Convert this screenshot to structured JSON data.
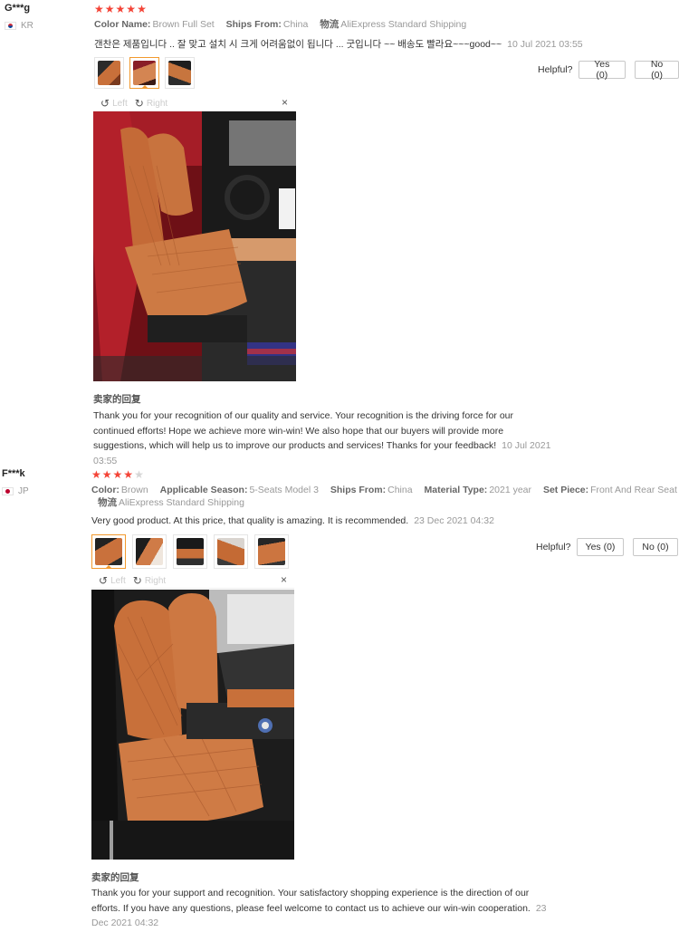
{
  "reviews": [
    {
      "user": "G***g",
      "country": "KR",
      "rating": 5,
      "attributes": [
        {
          "label": "Color Name:",
          "value": "Brown Full Set"
        },
        {
          "label": "Ships From:",
          "value": "China"
        },
        {
          "label": "物流",
          "value": "AliExpress Standard Shipping"
        }
      ],
      "feedback": "갠찬은 제품입니다 .. 잘 맞고 설치 시 크게 어려움없이 됩니다 ... 굿입니다 ~~ 배송도 빨라요~~~good~~",
      "date": "10 Jul 2021 03:55",
      "helpful_label": "Helpful?",
      "yes_label": "Yes (0)",
      "no_label": "No (0)",
      "viewer": {
        "left": "Left",
        "right": "Right",
        "close": "×"
      },
      "seller_reply_title": "卖家的回复",
      "seller_reply_lines": [
        "Thank you for your recognition of our quality and service. Your recognition is the driving force for our",
        "continued efforts! Hope we achieve more win-win! We also hope that our buyers will provide more",
        "suggestions, which will help us to improve our products and services! Thanks for your feedback!"
      ],
      "seller_reply_date_a": "10 Jul 2021",
      "seller_reply_date_b": "03:55"
    },
    {
      "user": "F***k",
      "country": "JP",
      "rating": 4,
      "attributes": [
        {
          "label": "Color:",
          "value": "Brown"
        },
        {
          "label": "Applicable Season:",
          "value": "5-Seats Model 3"
        },
        {
          "label": "Ships From:",
          "value": "China"
        },
        {
          "label": "Material Type:",
          "value": "2021 year"
        },
        {
          "label": "Set Piece:",
          "value": "Front And Rear Seat"
        },
        {
          "label": "物流",
          "value": "AliExpress Standard Shipping"
        }
      ],
      "feedback": "Very good product. At this price, that quality is amazing. It is recommended.",
      "date": "23 Dec 2021 04:32",
      "helpful_label": "Helpful?",
      "yes_label": "Yes (0)",
      "no_label": "No (0)",
      "viewer": {
        "left": "Left",
        "right": "Right",
        "close": "×"
      },
      "seller_reply_title": "卖家的回复",
      "seller_reply_lines": [
        "Thank you for your support and recognition. Your satisfactory shopping experience is the direction of our",
        "efforts. If you have any questions, please feel welcome to contact us to achieve our win-win cooperation."
      ],
      "seller_reply_date_a": "23",
      "seller_reply_date_b": "Dec 2021 04:32"
    }
  ],
  "icons": {
    "star": "star-icon",
    "rotate_left": "rotate-left-icon",
    "rotate_right": "rotate-right-icon",
    "close": "close-icon"
  },
  "colors": {
    "star": "#f44336",
    "accent": "#f29a2e",
    "seat_leather": "#c8703a",
    "car_red": "#a51d27"
  }
}
